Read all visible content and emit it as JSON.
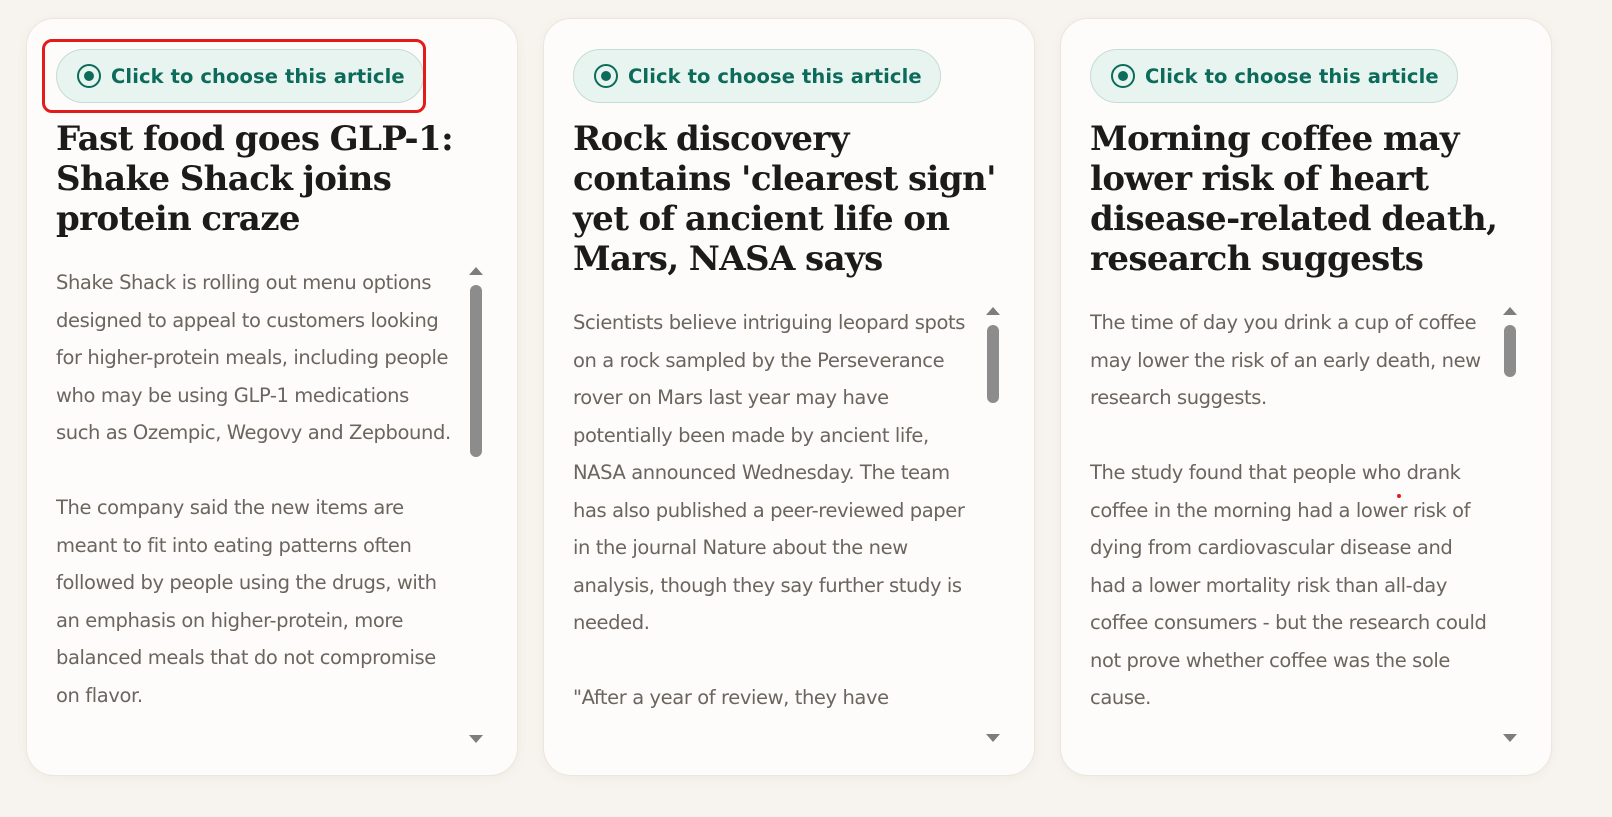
{
  "cards": [
    {
      "button_label": "Click to choose this article",
      "title": "Fast food goes GLP-1: Shake Shack joins protein craze",
      "body": "Shake Shack is rolling out menu options designed to appeal to customers looking for higher-protein meals, including people who may be using GLP-1 medications such as Ozempic, Wegovy and Zepbound.\n\nThe company said the new items are meant to fit into eating patterns often followed by people using the drugs, with an emphasis on higher-protein, more balanced meals that do not compromise on flavor.",
      "highlighted": true
    },
    {
      "button_label": "Click to choose this article",
      "title": "Rock discovery contains 'clearest sign' yet of ancient life on Mars, NASA says",
      "body": "Scientists believe intriguing leopard spots on a rock sampled by the Perseverance rover on Mars last year may have potentially been made by ancient life, NASA announced Wednesday. The team has also published a peer-reviewed paper in the journal Nature about the new analysis, though they say further study is needed.\n\n\"After a year of review, they have",
      "highlighted": false
    },
    {
      "button_label": "Click to choose this article",
      "title": "Morning coffee may lower risk of heart disease-related death, research suggests",
      "body": "The time of day you drink a cup of coffee may lower the risk of an early death, new research suggests.\n\nThe study found that people who drank coffee in the morning had a lower risk of dying from cardiovascular disease and had a lower mortality risk than all-day coffee consumers - but the research could not prove whether coffee was the sole cause.",
      "highlighted": false
    }
  ],
  "colors": {
    "accent": "#0c6b5a",
    "button_bg": "#e8f4f0",
    "highlight": "#e31b1b",
    "page_bg": "#f7f3ee"
  },
  "icons": {
    "choose": "radio-selected-icon"
  }
}
